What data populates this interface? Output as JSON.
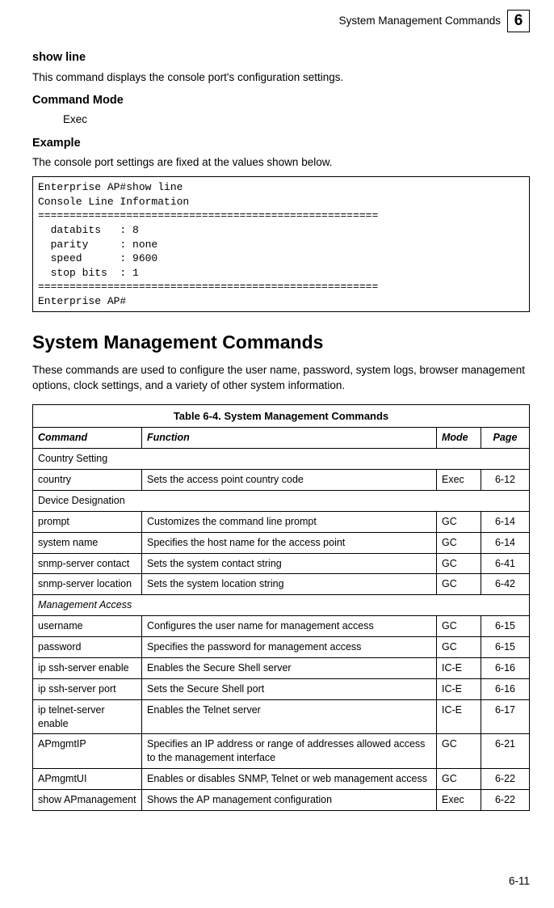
{
  "header": {
    "title": "System Management Commands",
    "chapter": "6"
  },
  "showline": {
    "title": "show line",
    "desc": "This command displays the console port's configuration settings.",
    "cmdmode_label": "Command Mode",
    "cmdmode_value": "Exec",
    "example_label": "Example",
    "example_intro": "The console port settings are fixed at the values shown below.",
    "code": "Enterprise AP#show line\nConsole Line Information\n======================================================\n  databits   : 8\n  parity     : none\n  speed      : 9600\n  stop bits  : 1\n======================================================\nEnterprise AP#"
  },
  "section": {
    "title": "System Management Commands",
    "intro": "These commands are used to configure the user name, password, system logs, browser management options, clock settings, and a variety of other system information."
  },
  "table": {
    "caption": "Table 6-4. System Management Commands",
    "headers": {
      "command": "Command",
      "function": "Function",
      "mode": "Mode",
      "page": "Page"
    },
    "groups": {
      "country": "Country Setting",
      "device": "Device Designation",
      "mgmt": "Management Access"
    },
    "rows": {
      "r1": {
        "cmd": "country",
        "fn": "Sets the access point country code",
        "mode": "Exec",
        "page": "6-12"
      },
      "r2": {
        "cmd": "prompt",
        "fn": "Customizes the command line prompt",
        "mode": "GC",
        "page": "6-14"
      },
      "r3": {
        "cmd": "system name",
        "fn": "Specifies the host name for the access point",
        "mode": "GC",
        "page": "6-14"
      },
      "r4": {
        "cmd": "snmp-server contact",
        "fn": "Sets the system contact string",
        "mode": "GC",
        "page": "6-41"
      },
      "r5": {
        "cmd": "snmp-server location",
        "fn": "Sets the system location string",
        "mode": "GC",
        "page": "6-42"
      },
      "r6": {
        "cmd": "username",
        "fn": "Configures the user name for management access",
        "mode": "GC",
        "page": "6-15"
      },
      "r7": {
        "cmd": "password",
        "fn": "Specifies the password for management access",
        "mode": "GC",
        "page": "6-15"
      },
      "r8": {
        "cmd": "ip ssh-server enable",
        "fn": "Enables the Secure Shell server",
        "mode": "IC-E",
        "page": "6-16"
      },
      "r9": {
        "cmd": "ip ssh-server port",
        "fn": "Sets the Secure Shell port",
        "mode": "IC-E",
        "page": "6-16"
      },
      "r10": {
        "cmd": "ip telnet-server enable",
        "fn": "Enables the Telnet server",
        "mode": "IC-E",
        "page": "6-17"
      },
      "r11": {
        "cmd": "APmgmtIP",
        "fn": "Specifies an IP address or range of addresses allowed access to the management interface",
        "mode": "GC",
        "page": "6-21"
      },
      "r12": {
        "cmd": "APmgmtUI",
        "fn": "Enables or disables SNMP, Telnet or web management access",
        "mode": "GC",
        "page": "6-22"
      },
      "r13": {
        "cmd": "show APmanagement",
        "fn": "Shows the AP management configuration",
        "mode": "Exec",
        "page": "6-22"
      }
    }
  },
  "footer": {
    "page": "6-11"
  }
}
